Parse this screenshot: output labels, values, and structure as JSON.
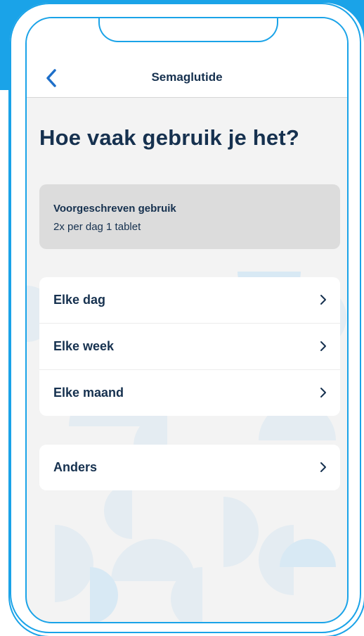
{
  "nav": {
    "title": "Semaglutide",
    "back_icon": "chevron-left-icon"
  },
  "page": {
    "title": "Hoe vaak gebruik je het?"
  },
  "prescription": {
    "label": "Voorgeschreven gebruik",
    "value": "2x per dag 1 tablet"
  },
  "frequency_options": [
    {
      "label": "Elke dag"
    },
    {
      "label": "Elke week"
    },
    {
      "label": "Elke maand"
    }
  ],
  "other_option": {
    "label": "Anders"
  },
  "colors": {
    "accent": "#1aa3e8",
    "text": "#16314f",
    "background": "#f3f3f3",
    "card": "#ffffff",
    "prescription_bg": "#dcdcdc"
  }
}
